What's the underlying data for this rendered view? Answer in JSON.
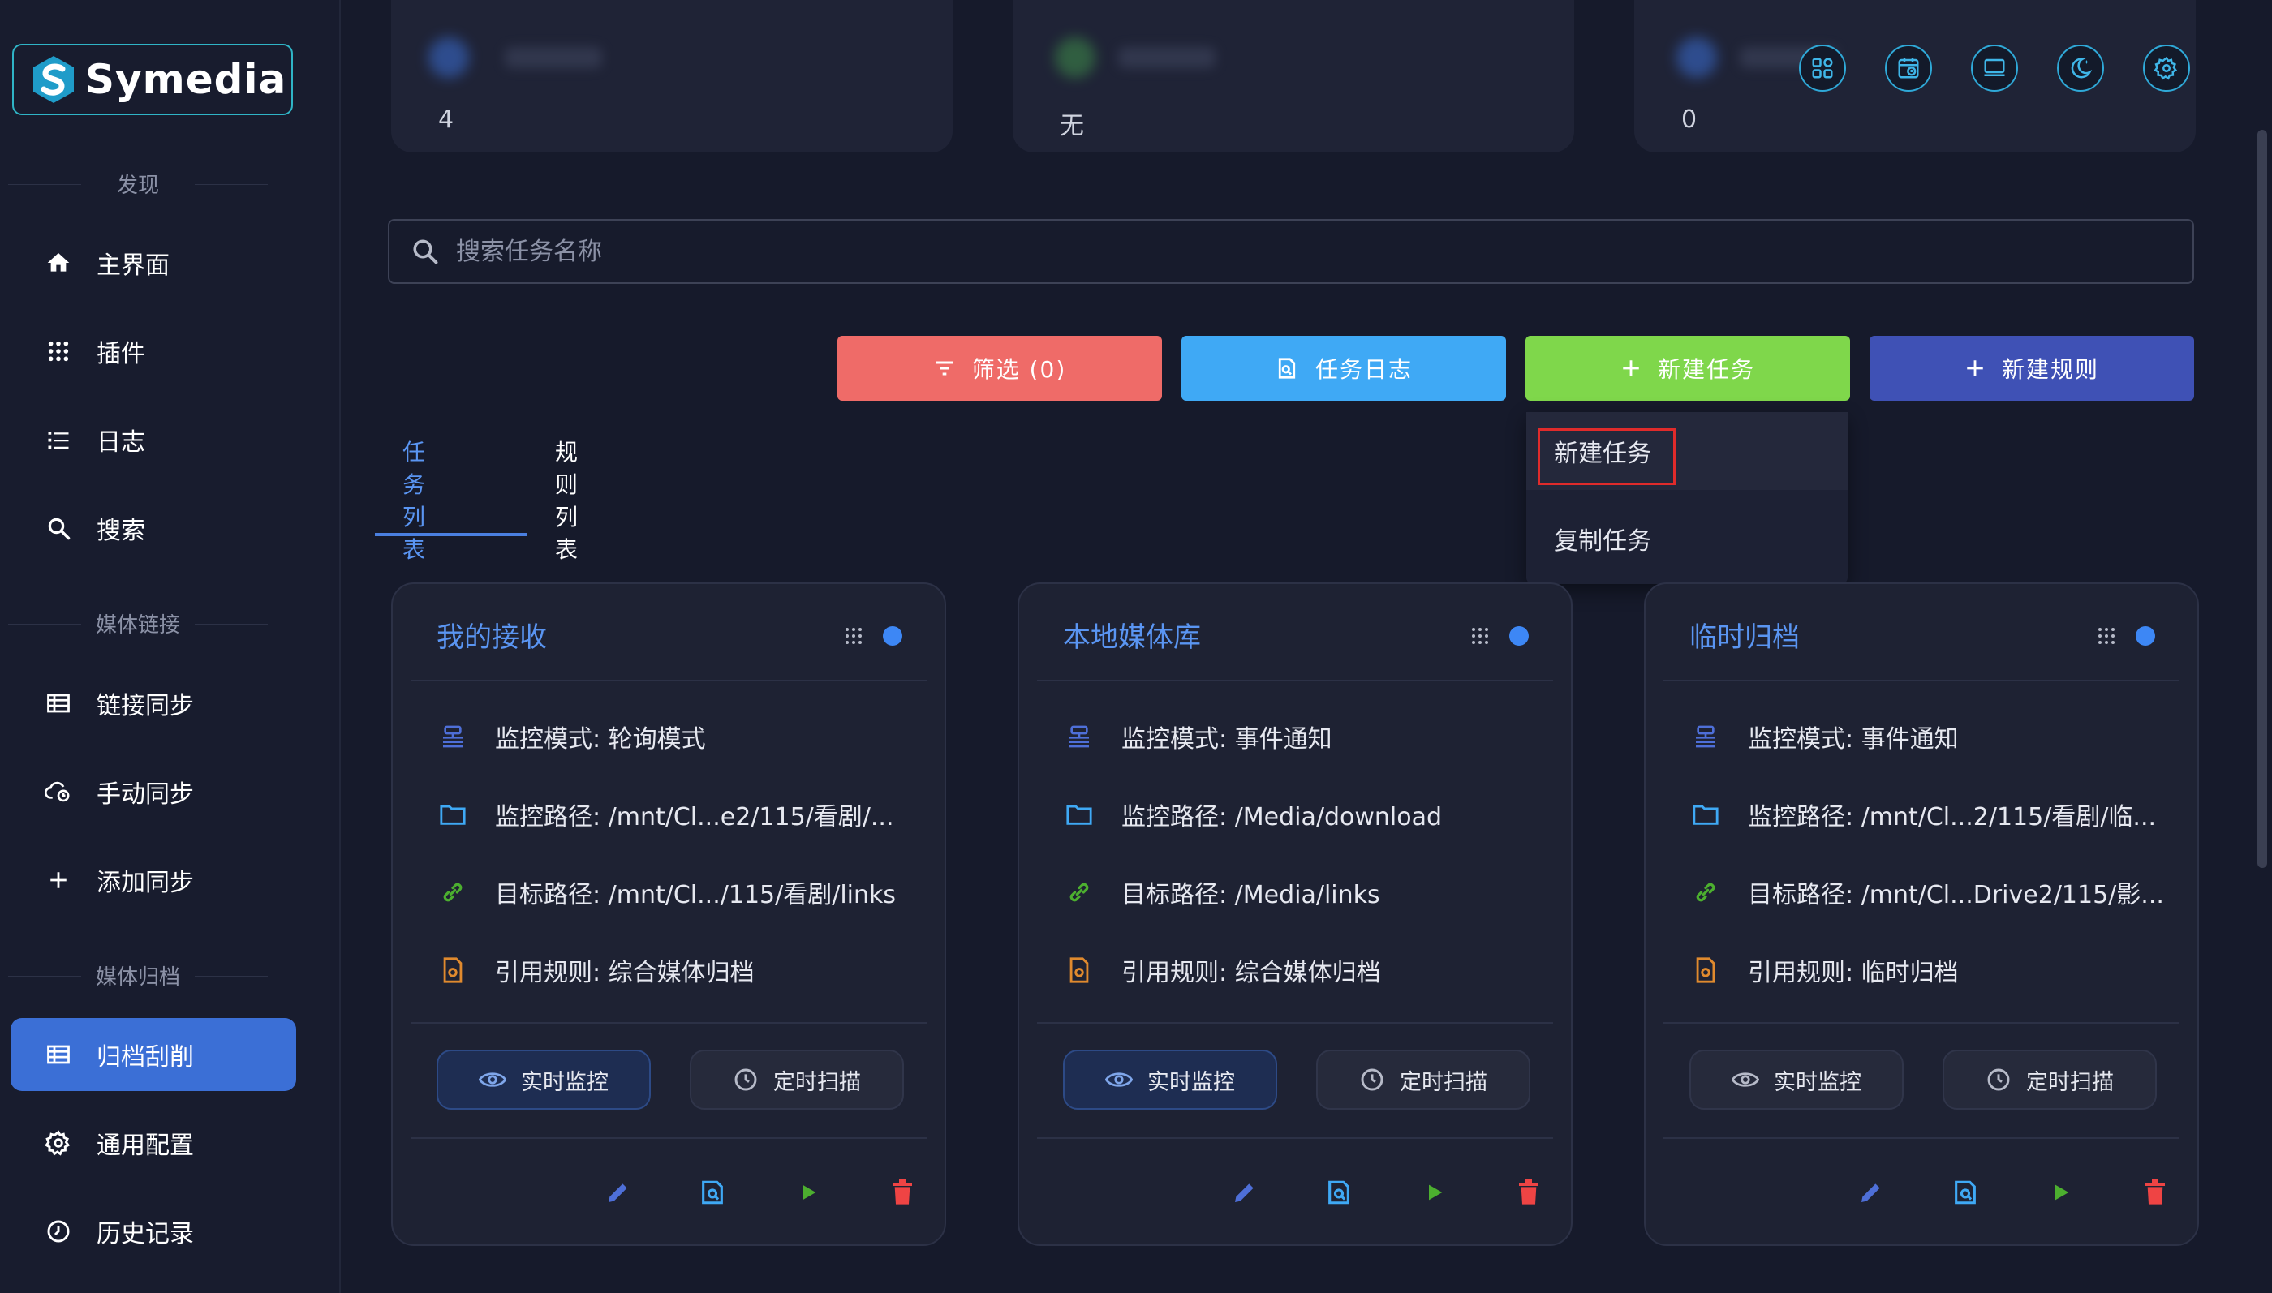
{
  "brand": {
    "name": "Symedia"
  },
  "sidebar": {
    "sections": [
      "发现",
      "媒体链接",
      "媒体归档"
    ],
    "items": [
      {
        "label": "主界面",
        "icon": "home-icon"
      },
      {
        "label": "插件",
        "icon": "apps-grid-icon"
      },
      {
        "label": "日志",
        "icon": "list-icon"
      },
      {
        "label": "搜索",
        "icon": "search-icon"
      },
      {
        "label": "链接同步",
        "icon": "table-icon"
      },
      {
        "label": "手动同步",
        "icon": "cloud-sync-icon"
      },
      {
        "label": "添加同步",
        "icon": "plus-icon"
      },
      {
        "label": "归档刮削",
        "icon": "table-icon",
        "active": true
      },
      {
        "label": "通用配置",
        "icon": "gear-icon"
      },
      {
        "label": "历史记录",
        "icon": "history-icon"
      }
    ]
  },
  "stats": [
    {
      "value": "4"
    },
    {
      "value": "无"
    },
    {
      "value": "0"
    }
  ],
  "topbar": {
    "icons": [
      "widgets-icon",
      "calendar-clock-icon",
      "monitor-icon",
      "theme-moon-icon",
      "settings-icon"
    ]
  },
  "search": {
    "placeholder": "搜索任务名称",
    "value": ""
  },
  "actions": {
    "filter": "筛选 (0)",
    "task_log": "任务日志",
    "new_task": "新建任务",
    "new_rule": "新建规则"
  },
  "dropdown": {
    "items": [
      "新建任务",
      "复制任务"
    ],
    "highlighted": 0
  },
  "tabs": {
    "items": [
      "任务列表",
      "规则列表"
    ],
    "active": 0
  },
  "labels": {
    "monitor_mode": "监控模式",
    "monitor_path": "监控路径",
    "target_path": "目标路径",
    "rule": "引用规则",
    "realtime": "实时监控",
    "scheduled": "定时扫描"
  },
  "cards": [
    {
      "title": "我的接收",
      "monitor_mode": "监控模式: 轮询模式",
      "monitor_path": "监控路径: /mnt/Cl...e2/115/看剧/...",
      "target_path": "目标路径: /mnt/Cl.../115/看剧/links",
      "rule": "引用规则: 综合媒体归档",
      "realtime_on": true
    },
    {
      "title": "本地媒体库",
      "monitor_mode": "监控模式: 事件通知",
      "monitor_path": "监控路径: /Media/download",
      "target_path": "目标路径: /Media/links",
      "rule": "引用规则: 综合媒体归档",
      "realtime_on": true
    },
    {
      "title": "临时归档",
      "monitor_mode": "监控模式: 事件通知",
      "monitor_path": "监控路径: /mnt/Cl...2/115/看剧/临...",
      "target_path": "目标路径: /mnt/Cl...Drive2/115/影...",
      "rule": "引用规则: 临时归档",
      "realtime_on": false
    }
  ],
  "colors": {
    "accent": "#3b6fd6",
    "filter": "#ef6b68",
    "task_log": "#3fa9f5",
    "new_task": "#7fd74b",
    "new_rule": "#3f51b5",
    "card_title": "#5a95f2",
    "status_dot": "#3d87f5",
    "delete": "#ef4444",
    "run": "#4caf2f"
  }
}
